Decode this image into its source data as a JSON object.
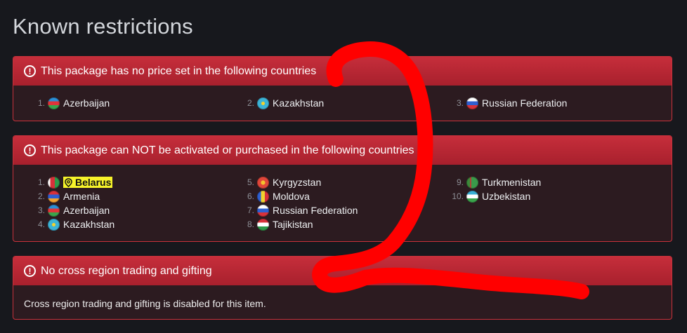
{
  "page": {
    "title": "Known restrictions"
  },
  "panels": {
    "no_price": {
      "title": "This package has no price set in the following countries",
      "countries": [
        {
          "num": "1.",
          "name": "Azerbaijan",
          "flag": "linear-gradient(#2b8fd6 0 33%, #e0343a 33% 66%, #3aa54c 66%)"
        },
        {
          "num": "2.",
          "name": "Kazakhstan",
          "flag": "radial-gradient(circle at 50% 50%, #f2d22e 0 20%, #3cb3d6 21%)"
        },
        {
          "num": "3.",
          "name": "Russian Federation",
          "flag": "linear-gradient(#ffffff 0 33%, #2f5fd0 33% 66%, #d8323a 66%)"
        }
      ]
    },
    "blocked": {
      "title": "This package can NOT be activated or purchased in the following countries",
      "countries": [
        {
          "num": "1.",
          "name": "Belarus",
          "highlighted": true,
          "flag": "linear-gradient(90deg, #ffffff 0 22%, #d8323a 22% 60%, #2f9a4a 60%)"
        },
        {
          "num": "2.",
          "name": "Armenia",
          "flag": "linear-gradient(#d8323a 0 33%, #2f5fd0 33% 66%, #f0a232 66%)"
        },
        {
          "num": "3.",
          "name": "Azerbaijan",
          "flag": "linear-gradient(#2b8fd6 0 33%, #e0343a 33% 66%, #3aa54c 66%)"
        },
        {
          "num": "4.",
          "name": "Kazakhstan",
          "flag": "radial-gradient(circle at 50% 50%, #f2d22e 0 20%, #3cb3d6 21%)"
        },
        {
          "num": "5.",
          "name": "Kyrgyzstan",
          "flag": "radial-gradient(circle at 50% 50%, #f2c22e 0 25%, #e0463a 26%)"
        },
        {
          "num": "6.",
          "name": "Moldova",
          "flag": "linear-gradient(90deg, #2f5fd0 0 33%, #f2d22e 33% 66%, #d8323a 66%)"
        },
        {
          "num": "7.",
          "name": "Russian Federation",
          "flag": "linear-gradient(#ffffff 0 33%, #2f5fd0 33% 66%, #d8323a 66%)"
        },
        {
          "num": "8.",
          "name": "Tajikistan",
          "flag": "linear-gradient(#d8323a 0 33%, #ffffff 33% 66%, #2f9a4a 66%)"
        },
        {
          "num": "9.",
          "name": "Turkmenistan",
          "flag": "linear-gradient(90deg, #3a8a3a 0 30%, #b0413a 30% 40%, #3a9a4a 40%)"
        },
        {
          "num": "10.",
          "name": "Uzbekistan",
          "flag": "linear-gradient(#3ab0d6 0 33%, #ffffff 33% 66%, #3aa54c 66%)"
        }
      ]
    },
    "trading": {
      "title": "No cross region trading and gifting",
      "body": "Cross region trading and gifting is disabled for this item."
    }
  },
  "colors": {
    "background": "#17181d",
    "panel_header": "#c62e3b",
    "panel_body": "#2c1b20",
    "highlight": "#f7f32a",
    "scribble": "#ff0000"
  }
}
